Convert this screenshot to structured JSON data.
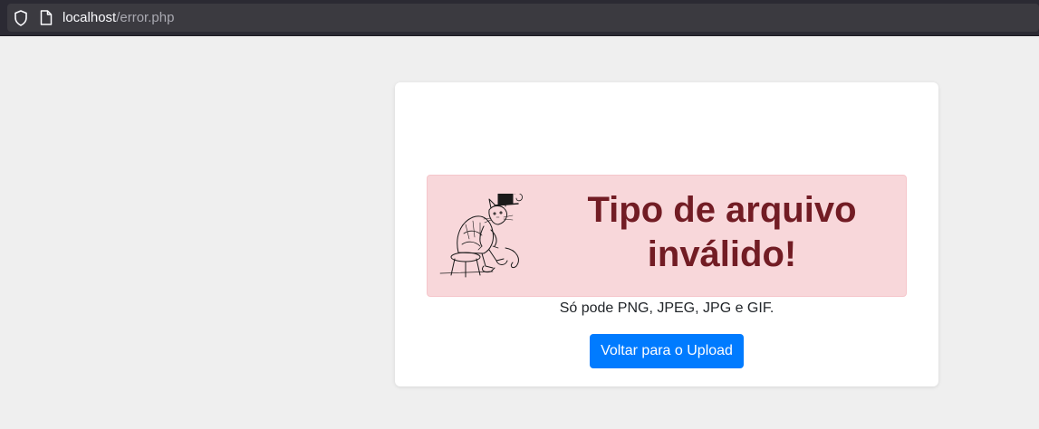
{
  "browser": {
    "url_host": "localhost",
    "url_path": "/error.php"
  },
  "alert": {
    "title": "Tipo de arquivo inválido!",
    "illustration": "cat-with-top-hat-sketch",
    "background_color": "#f8d7da",
    "text_color": "#721c24"
  },
  "main": {
    "message": "Só pode PNG, JPEG, JPG e GIF.",
    "back_button_label": "Voltar para o Upload",
    "button_color": "#007bff"
  }
}
